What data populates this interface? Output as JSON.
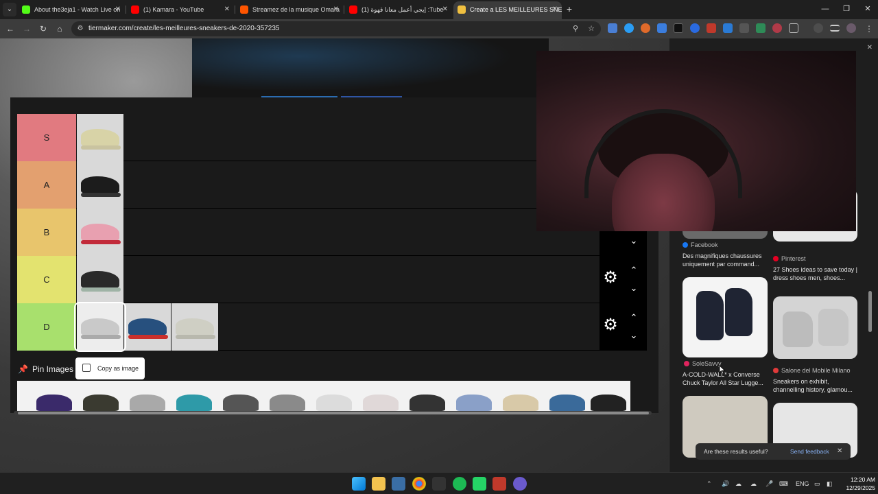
{
  "browser": {
    "tabs": [
      {
        "title": "About the3eja1 - Watch Live on",
        "favicon_color": "#53fc18"
      },
      {
        "title": "(1) Kamara - YouTube",
        "favicon_color": "#ff0000"
      },
      {
        "title": "Streamez de la musique Omara",
        "favicon_color": "#ff5500"
      },
      {
        "title": "(1) إيجي أعمل معانا قهوة :Tube",
        "favicon_color": "#ff0000"
      },
      {
        "title": "Create a LES MEILLEURES SNEA",
        "favicon_color": "#f0c040",
        "active": true
      }
    ],
    "url": "tiermaker.com/create/les-meilleures-sneakers-de-2020-357235"
  },
  "tier_list": {
    "tiers": [
      {
        "label": "S",
        "color": "#e17a80"
      },
      {
        "label": "A",
        "color": "#e3a06f"
      },
      {
        "label": "B",
        "color": "#e8c56c"
      },
      {
        "label": "C",
        "color": "#e3e36f"
      },
      {
        "label": "D",
        "color": "#a8e06d"
      }
    ],
    "pin_images_label": "Pin Images",
    "copy_as_image_label": "Copy as image"
  },
  "side_panel": {
    "results": [
      {
        "source": "Facebook",
        "source_color": "#1877f2",
        "description": "Des magnifiques chaussures uniquement par command..."
      },
      {
        "source": "Pinterest",
        "source_color": "#e60023",
        "description": "27 Shoes ideas to save today | dress shoes men, shoes..."
      },
      {
        "source": "SoleSavvy",
        "source_color": "#e0245e",
        "description": "A-COLD-WALL* x Converse Chuck Taylor All Star Lugge..."
      },
      {
        "source": "Salone del Mobile Milano",
        "source_color": "#e03a3a",
        "description": "Sneakers on exhibit, channelling history, glamou..."
      }
    ],
    "feedback_question": "Are these results useful?",
    "send_feedback": "Send feedback"
  },
  "taskbar": {
    "language": "ENG",
    "time": "12:20 AM",
    "date": "12/29/2025"
  }
}
